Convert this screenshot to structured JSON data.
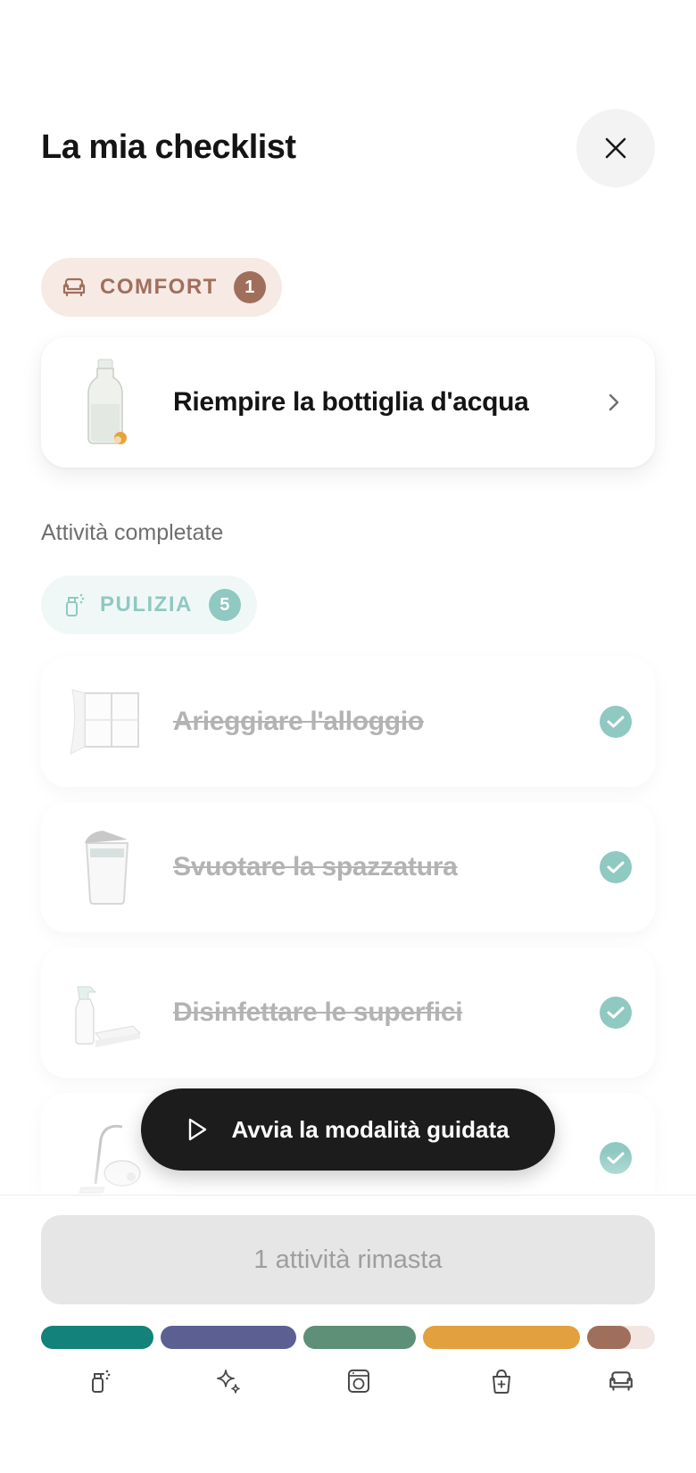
{
  "header": {
    "title": "La mia checklist"
  },
  "pending": {
    "category": {
      "label": "COMFORT",
      "count": "1"
    },
    "items": [
      {
        "label": "Riempire la bottiglia d'acqua",
        "thumb": "water-bottle"
      }
    ]
  },
  "completed": {
    "section_title": "Attività completate",
    "category": {
      "label": "PULIZIA",
      "count": "5"
    },
    "items": [
      {
        "label": "Arieggiare l'alloggio",
        "thumb": "window"
      },
      {
        "label": "Svuotare la spazzatura",
        "thumb": "trash-bin"
      },
      {
        "label": "Disinfettare le superfici",
        "thumb": "spray-bottle"
      },
      {
        "label": "",
        "thumb": "vacuum-cleaner"
      }
    ]
  },
  "guided_mode": {
    "label": "Avvia la modalità guidata"
  },
  "footer": {
    "remaining_label": "1 attività rimasta",
    "progress": [
      {
        "name": "pulizia",
        "color": "#12827a",
        "fraction": 1.0
      },
      {
        "name": "magia",
        "color": "#5c5f92",
        "fraction": 1.0
      },
      {
        "name": "lavanderia",
        "color": "#5e8f77",
        "fraction": 1.0
      },
      {
        "name": "cucina",
        "color": "#e3a03e",
        "fraction": 1.0
      },
      {
        "name": "comfort",
        "color": "#a06f5c",
        "fraction": 0.65
      }
    ],
    "nav_icons": [
      "spray-icon",
      "sparkles-icon",
      "washing-machine-icon",
      "bag-icon",
      "armchair-icon"
    ]
  }
}
